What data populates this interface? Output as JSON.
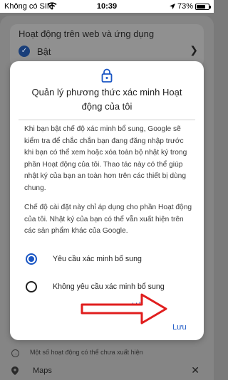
{
  "status_bar": {
    "carrier": "Không có SIM",
    "time": "10:39",
    "battery": "73%",
    "battery_level": 0.73
  },
  "background": {
    "title": "Hoạt động trên web và ứng dụng",
    "status": "Bật",
    "info_text": "Một số hoạt động có thể chưa xuất hiện",
    "maps_label": "Maps"
  },
  "dialog": {
    "title": "Quản lý phương thức xác minh Hoạt động của tôi",
    "paragraph1": "Khi bạn bật chế độ xác minh bổ sung, Google sẽ kiểm tra để chắc chắn bạn đang đăng nhập trước khi bạn có thể xem hoặc xóa toàn bộ nhật ký trong phần Hoạt động của tôi. Thao tác này có thể giúp nhật ký của bạn an toàn hơn trên các thiết bị dùng chung.",
    "paragraph2": "Chế độ cài đặt này chỉ áp dụng cho phần Hoạt động của tôi. Nhật ký của bạn có thể vẫn xuất hiện trên các sản phẩm khác của Google.",
    "options": [
      {
        "label": "Yêu cầu xác minh bổ sung",
        "selected": true
      },
      {
        "label": "Không yêu cầu xác minh bổ sung",
        "selected": false
      }
    ],
    "cancel_label": "Hủy",
    "save_label": "Lưu"
  },
  "colors": {
    "accent": "#1a56c4",
    "annotation_arrow": "#e01e1e"
  }
}
